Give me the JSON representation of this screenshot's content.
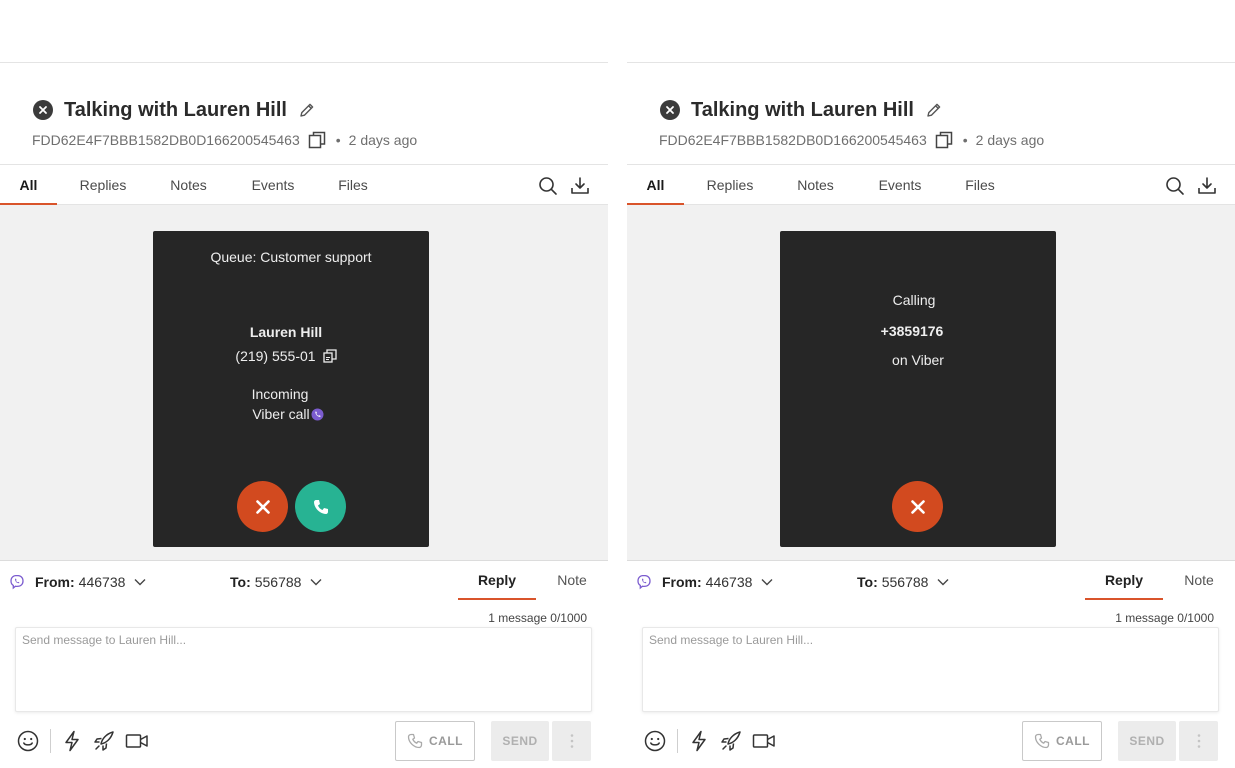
{
  "panels": [
    {
      "title": "Talking with Lauren Hill",
      "conversation_id": "FDD62E4F7BBB1582DB0D166200545463",
      "separator": "•",
      "time_ago": "2 days ago",
      "tabs": [
        "All",
        "Replies",
        "Notes",
        "Events",
        "Files"
      ],
      "active_tab": "All",
      "card": {
        "queue": "Queue: Customer support",
        "caller_name": "Lauren Hill",
        "caller_phone": "(219) 555-01",
        "status_line1": "Incoming",
        "status_line2": "Viber call"
      },
      "composer": {
        "from_label": "From:",
        "from_value": "446738",
        "to_label": "To:",
        "to_value": "556788",
        "reply_tab": "Reply",
        "note_tab": "Note",
        "counter": "1 message 0/1000",
        "placeholder": "Send message to Lauren Hill...",
        "call_label": "CALL",
        "send_label": "SEND"
      }
    },
    {
      "title": "Talking with Lauren Hill",
      "conversation_id": "FDD62E4F7BBB1582DB0D166200545463",
      "separator": "•",
      "time_ago": "2 days ago",
      "tabs": [
        "All",
        "Replies",
        "Notes",
        "Events",
        "Files"
      ],
      "active_tab": "All",
      "card": {
        "status": "Calling",
        "phone": "+3859176",
        "channel": "on Viber"
      },
      "composer": {
        "from_label": "From:",
        "from_value": "446738",
        "to_label": "To:",
        "to_value": "556788",
        "reply_tab": "Reply",
        "note_tab": "Note",
        "counter": "1 message 0/1000",
        "placeholder": "Send message to Lauren Hill...",
        "call_label": "CALL",
        "send_label": "SEND"
      }
    }
  ],
  "colors": {
    "accent": "#d9542b",
    "decline": "#d24a1f",
    "accept": "#27b393",
    "card_bg": "#262626",
    "viber": "#7b5ccf"
  },
  "icons": {
    "close": "close-circle-icon",
    "edit": "pencil-icon",
    "copy": "copy-icon",
    "search": "search-icon",
    "download": "download-icon",
    "viber": "viber-icon",
    "chevron": "chevron-down-icon",
    "emoji": "emoji-icon",
    "quick_reply": "lightning-icon",
    "campaign": "rocket-icon",
    "video": "video-icon",
    "phone": "phone-icon",
    "decline": "x-icon",
    "more": "more-vertical-icon"
  }
}
